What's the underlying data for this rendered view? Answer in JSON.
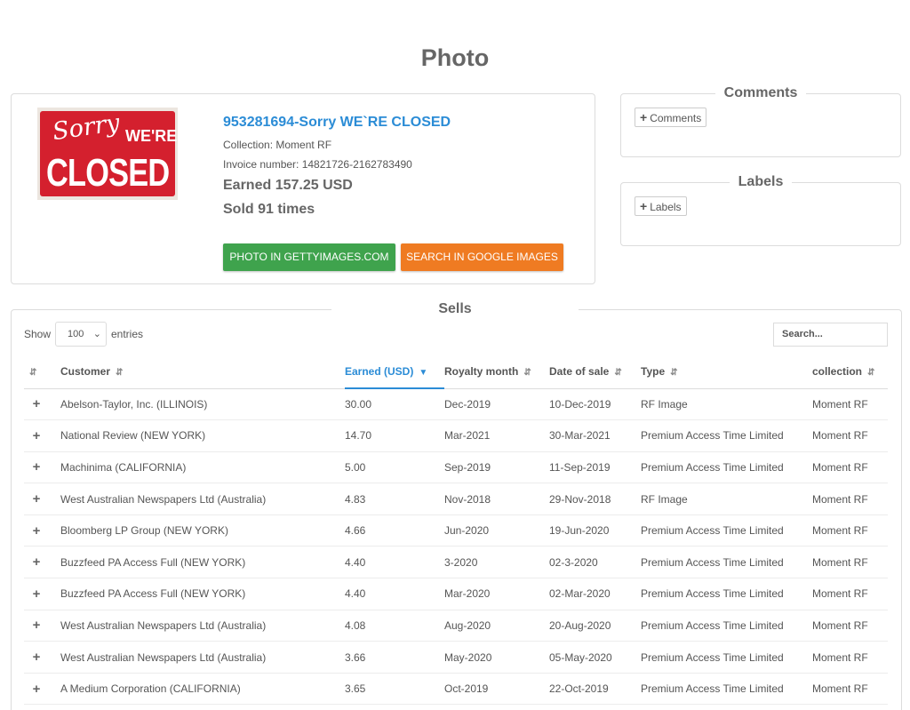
{
  "page": {
    "title": "Photo"
  },
  "photo": {
    "sign_text": {
      "line1": "Sorry",
      "line2": "WE'RE",
      "line3": "CLOSED"
    },
    "title": "953281694-Sorry WE`RE CLOSED",
    "collection": "Collection: Moment RF",
    "invoice": "Invoice number: 14821726-2162783490",
    "earned": "Earned 157.25 USD",
    "sold": "Sold 91 times",
    "buttons": {
      "getty": "PHOTO IN GETTYIMAGES.COM",
      "google": "SEARCH IN GOOGLE IMAGES"
    },
    "colors": {
      "link": "#2b8cd6",
      "getty_button": "#3fa34d",
      "google_button": "#ef7b22"
    }
  },
  "comments": {
    "title": "Comments",
    "add_button": "Comments",
    "icon": "plus-icon"
  },
  "labels": {
    "title": "Labels",
    "add_button": "Labels",
    "icon": "plus-icon"
  },
  "sells": {
    "title": "Sells",
    "show_label": "Show",
    "entries_value": "100",
    "entries_label": "entries",
    "search_placeholder": "Search...",
    "columns": [
      "Customer",
      "Earned (USD)",
      "Royalty month",
      "Date of sale",
      "Type",
      "collection"
    ],
    "sorted_column": "Earned (USD)",
    "rows": [
      {
        "customer": "Abelson-Taylor, Inc. (ILLINOIS)",
        "earned": "30.00",
        "royalty": "Dec-2019",
        "date": "10-Dec-2019",
        "type": "RF Image",
        "collection": "Moment RF"
      },
      {
        "customer": "National Review (NEW YORK)",
        "earned": "14.70",
        "royalty": "Mar-2021",
        "date": "30-Mar-2021",
        "type": "Premium Access Time Limited",
        "collection": "Moment RF"
      },
      {
        "customer": "Machinima (CALIFORNIA)",
        "earned": "5.00",
        "royalty": "Sep-2019",
        "date": "11-Sep-2019",
        "type": "Premium Access Time Limited",
        "collection": "Moment RF"
      },
      {
        "customer": "West Australian Newspapers Ltd (Australia)",
        "earned": "4.83",
        "royalty": "Nov-2018",
        "date": "29-Nov-2018",
        "type": "RF Image",
        "collection": "Moment RF"
      },
      {
        "customer": "Bloomberg LP Group (NEW YORK)",
        "earned": "4.66",
        "royalty": "Jun-2020",
        "date": "19-Jun-2020",
        "type": "Premium Access Time Limited",
        "collection": "Moment RF"
      },
      {
        "customer": "Buzzfeed PA Access Full (NEW YORK)",
        "earned": "4.40",
        "royalty": "3-2020",
        "date": "02-3-2020",
        "type": "Premium Access Time Limited",
        "collection": "Moment RF"
      },
      {
        "customer": "Buzzfeed PA Access Full (NEW YORK)",
        "earned": "4.40",
        "royalty": "Mar-2020",
        "date": "02-Mar-2020",
        "type": "Premium Access Time Limited",
        "collection": "Moment RF"
      },
      {
        "customer": "West Australian Newspapers Ltd (Australia)",
        "earned": "4.08",
        "royalty": "Aug-2020",
        "date": "20-Aug-2020",
        "type": "Premium Access Time Limited",
        "collection": "Moment RF"
      },
      {
        "customer": "West Australian Newspapers Ltd (Australia)",
        "earned": "3.66",
        "royalty": "May-2020",
        "date": "05-May-2020",
        "type": "Premium Access Time Limited",
        "collection": "Moment RF"
      },
      {
        "customer": "A Medium Corporation (CALIFORNIA)",
        "earned": "3.65",
        "royalty": "Oct-2019",
        "date": "22-Oct-2019",
        "type": "Premium Access Time Limited",
        "collection": "Moment RF"
      }
    ]
  }
}
